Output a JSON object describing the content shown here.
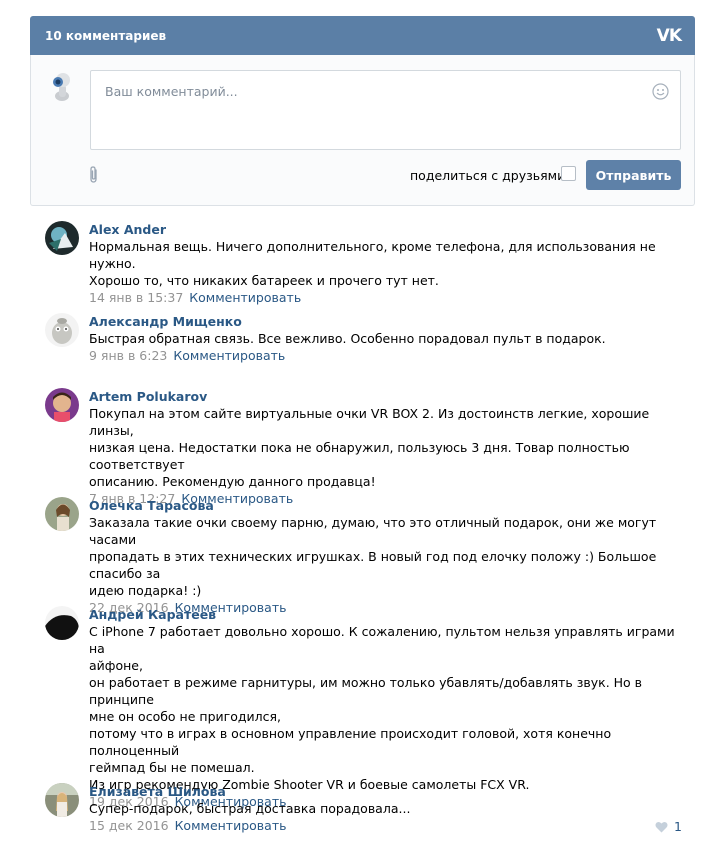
{
  "header": {
    "title": "10 комментариев",
    "logo": "VK"
  },
  "form": {
    "placeholder": "Ваш комментарий...",
    "share_label": "поделиться с друзьями",
    "send_label": "Отправить"
  },
  "comments": [
    {
      "name": "Alex Ander",
      "text": "Нормальная вещь. Ничего дополнительного, кроме телефона, для использования не нужно.\nХорошо то, что никаких батареек и прочего тут нет.",
      "date": "14 янв в 15:37",
      "reply": "Комментировать"
    },
    {
      "name": "Александр Мищенко",
      "text": "Быстрая обратная связь. Все вежливо. Особенно порадовал пульт в подарок.",
      "date": "9 янв в 6:23",
      "reply": "Комментировать"
    },
    {
      "name": "Artem Polukarov",
      "text": "Покупал на этом сайте виртуальные очки VR BOX 2. Из достоинств легкие, хорошие линзы,\nнизкая цена. Недостатки пока не обнаружил, пользуюсь 3 дня. Товар полностью соответствует\nописанию. Рекомендую данного продавца!",
      "date": "7 янв в 12:27",
      "reply": "Комментировать"
    },
    {
      "name": "Олечка Тарасова",
      "text": "Заказала такие очки своему парню, думаю, что это отличный подарок, они же могут часами\nпропадать в этих технических игрушках. В новый год под елочку положу :) Большое спасибо за\nидею подарка! :)",
      "date": "22 дек 2016",
      "reply": "Комментировать"
    },
    {
      "name": "Андрей Каратеев",
      "text": "С iPhone 7 работает довольно хорошо. К сожалению, пультом нельзя управлять играми на\nайфоне,\nон работает в режиме гарнитуры, им можно только убавлять/добавлять звук. Но в принципе\nмне он особо не пригодился,\nпотому что в играх в основном управление происходит головой, хотя конечно полноценный\nгеймпад бы не помешал.\nИз игр рекомендую Zombie Shooter VR и боевые самолеты FCX VR.",
      "date": "19 дек 2016",
      "reply": "Комментировать"
    },
    {
      "name": "Елизавета Шилова",
      "text": "Супер-подарок, быстрая доставка порадовала...",
      "date": "15 дек 2016",
      "reply": "Комментировать",
      "likes": "1"
    }
  ],
  "colors": {
    "header": "#5b7fa6",
    "link": "#2a5885",
    "button": "#5e81a8",
    "meta": "#939393"
  }
}
